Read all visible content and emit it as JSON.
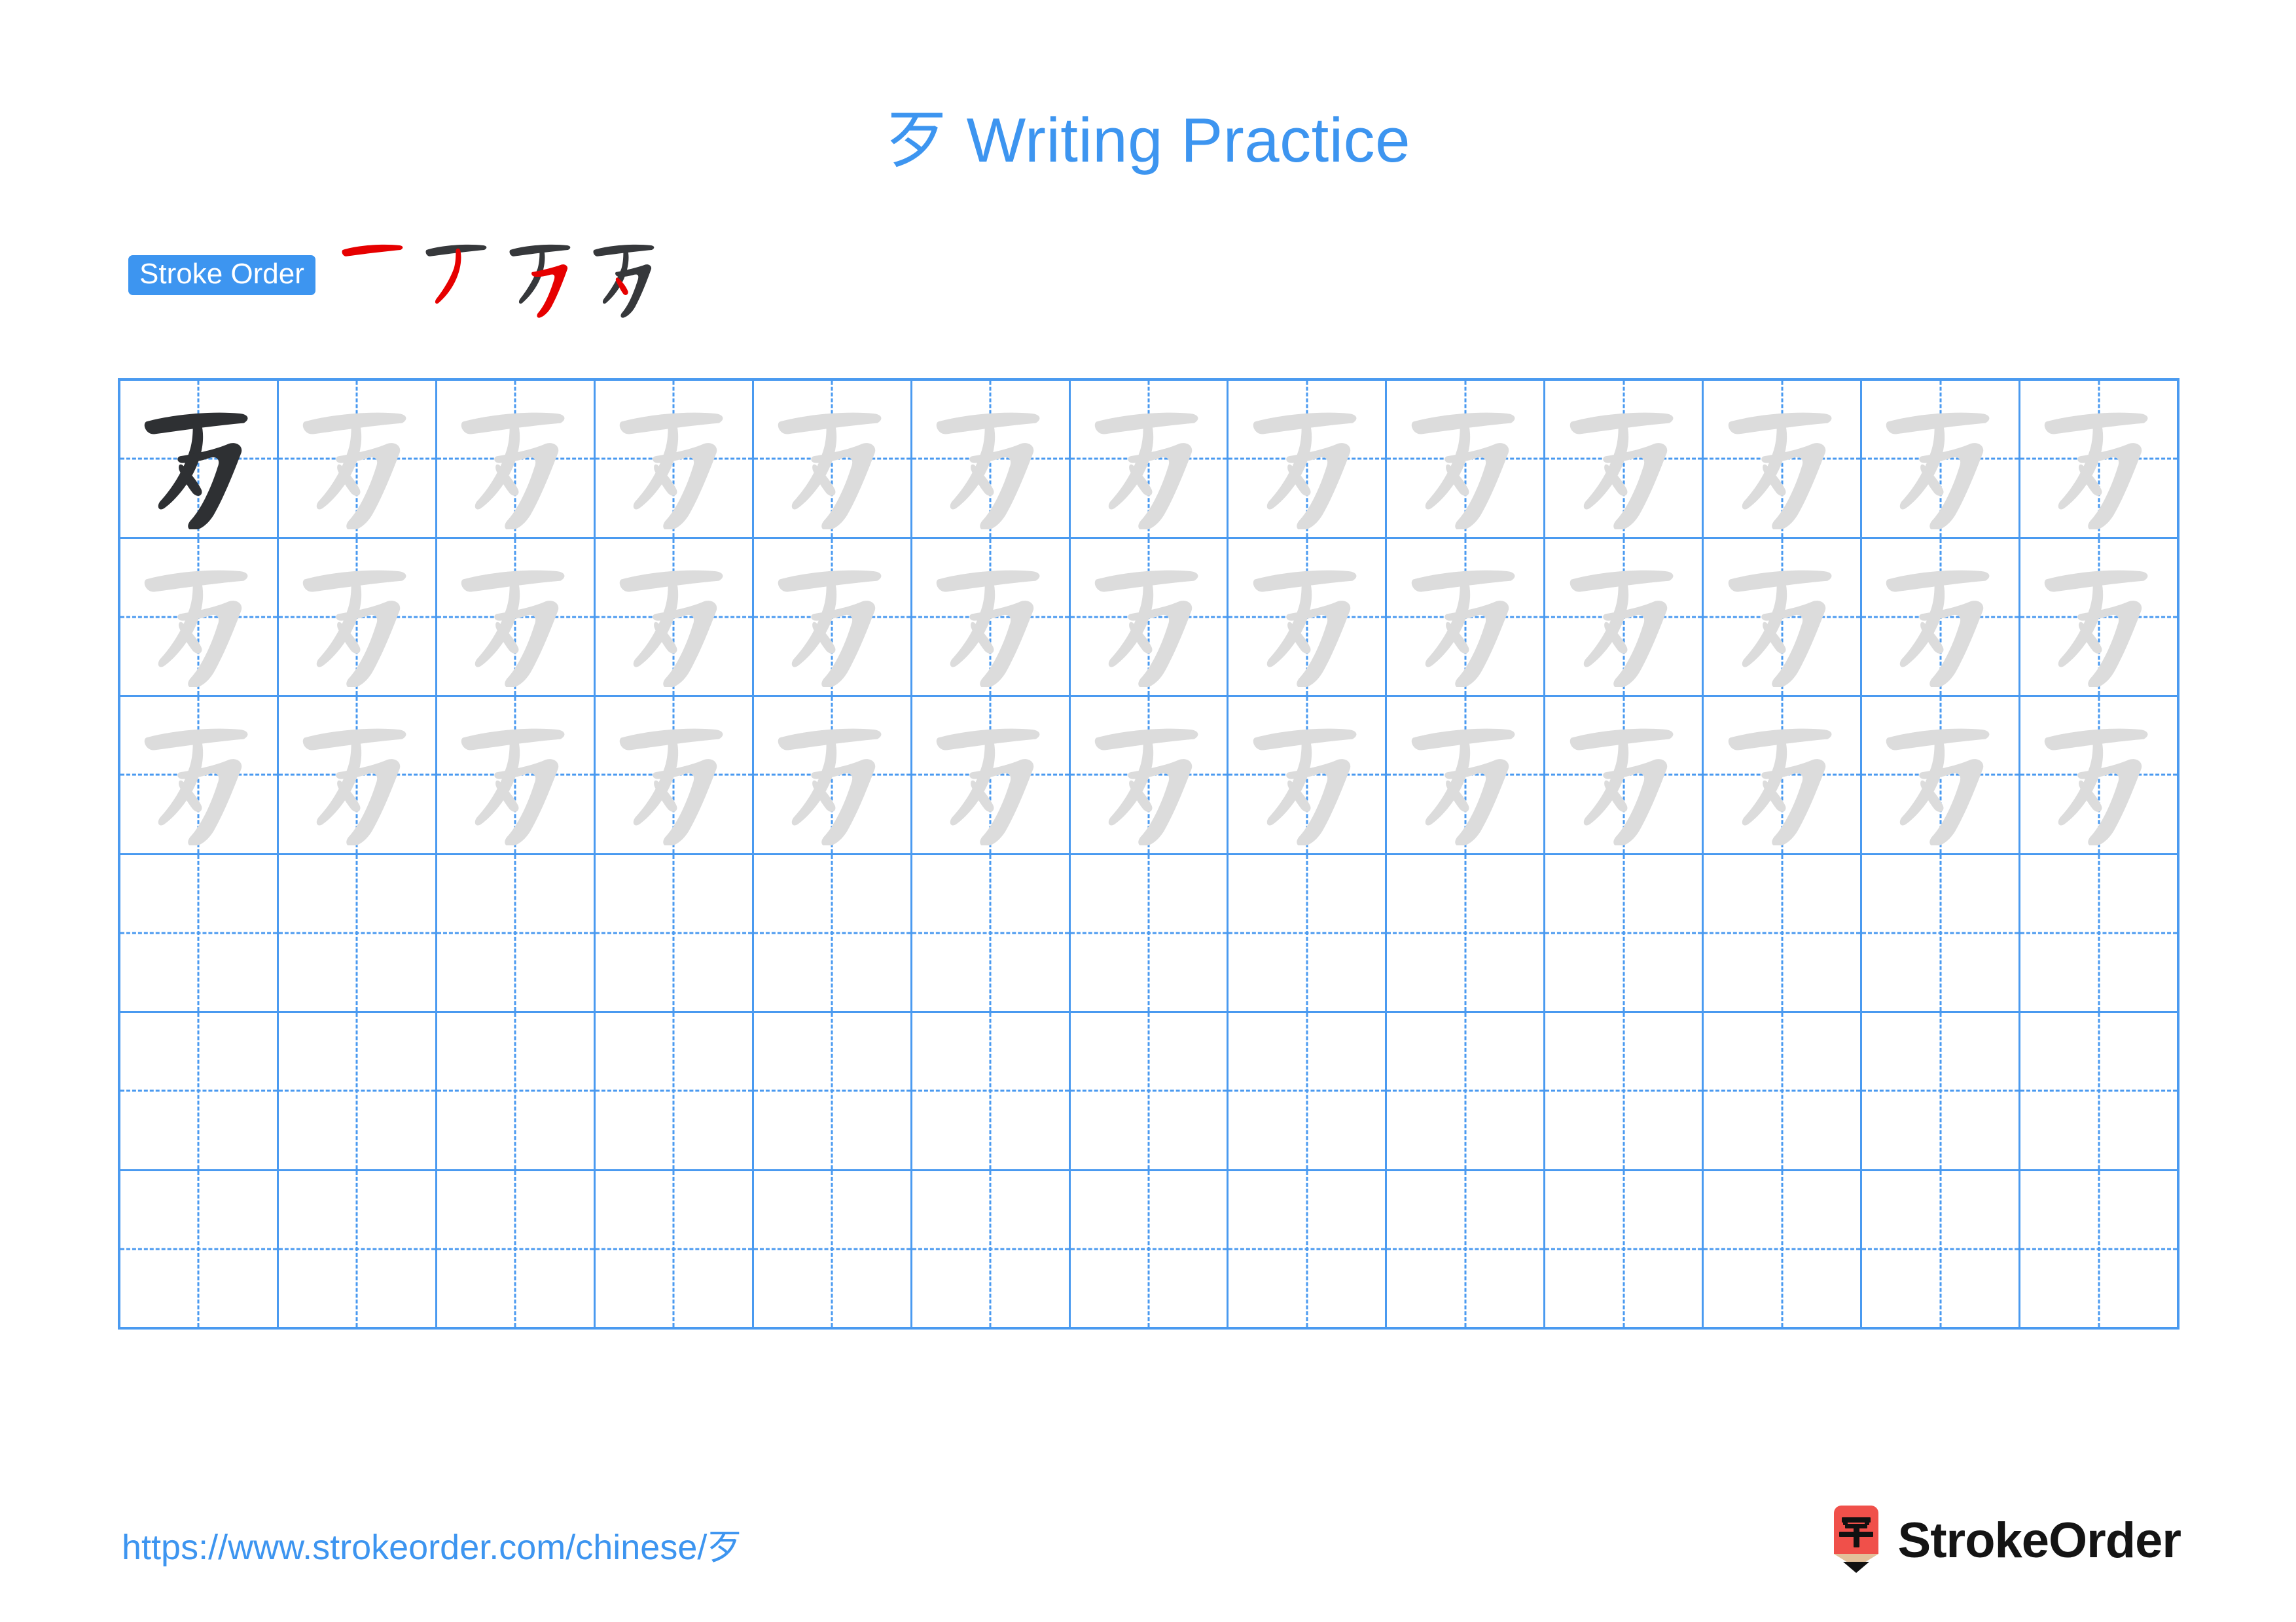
{
  "document": {
    "character": "歹",
    "title": "歹 Writing Practice",
    "title_suffix": " Writing Practice",
    "background_color": "#ffffff",
    "accent_color": "#3d95f0",
    "grid_line_color": "#4a9af0",
    "model_char_color": "#2e3033",
    "trace_char_color": "#dcdcdc",
    "highlight_stroke_color": "#e60000"
  },
  "stroke_order": {
    "badge_label": "Stroke Order",
    "badge_bg": "#3d95f0",
    "badge_text_color": "#ffffff",
    "stroke_count": 4,
    "steps": [
      {
        "step": 1,
        "strokes_shown": 1,
        "new_stroke": "heng (horizontal)"
      },
      {
        "step": 2,
        "strokes_shown": 2,
        "new_stroke": "pie (left-falling)"
      },
      {
        "step": 3,
        "strokes_shown": 3,
        "new_stroke": "hengzhegou (horizontal-bend-hook)"
      },
      {
        "step": 4,
        "strokes_shown": 4,
        "new_stroke": "dian (dot)"
      }
    ]
  },
  "grid": {
    "columns": 13,
    "rows": 6,
    "guide_lines": "dashed-crosshair",
    "row_contents": [
      {
        "row": 1,
        "model_cells": [
          1
        ],
        "trace_cells": 12,
        "empty_cells": 0
      },
      {
        "row": 2,
        "model_cells": [],
        "trace_cells": 13,
        "empty_cells": 0
      },
      {
        "row": 3,
        "model_cells": [],
        "trace_cells": 13,
        "empty_cells": 0
      },
      {
        "row": 4,
        "model_cells": [],
        "trace_cells": 0,
        "empty_cells": 13
      },
      {
        "row": 5,
        "model_cells": [],
        "trace_cells": 0,
        "empty_cells": 13
      },
      {
        "row": 6,
        "model_cells": [],
        "trace_cells": 0,
        "empty_cells": 13
      }
    ]
  },
  "footer": {
    "url": "https://www.strokeorder.com/chinese/歹",
    "brand_name": "StrokeOrder",
    "brand_icon_char": "字",
    "brand_icon_body_color": "#f0504a",
    "brand_icon_wood_color": "#e3c09a"
  }
}
